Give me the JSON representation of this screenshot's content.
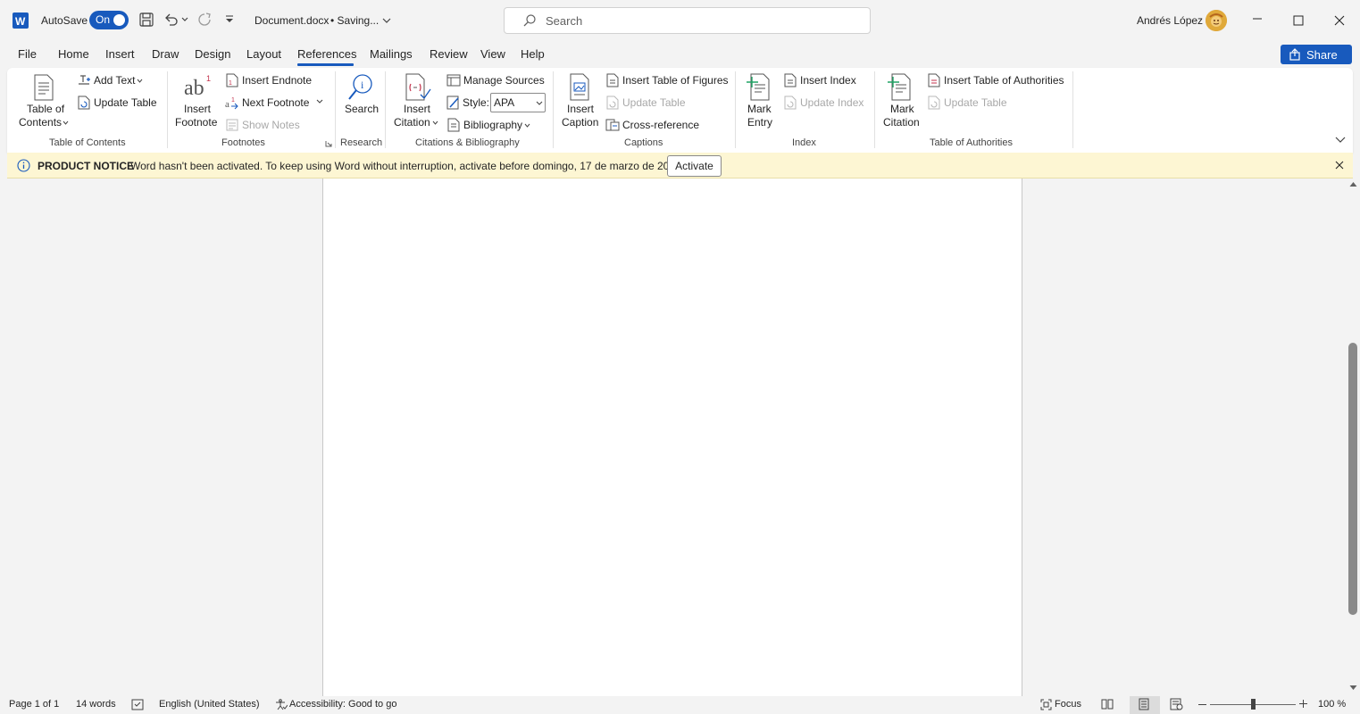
{
  "titlebar": {
    "autosave_label": "AutoSave",
    "autosave_state": "On",
    "doc_title": "Document.docx",
    "save_status": "•  Saving...",
    "search_placeholder": "Search",
    "user_name": "Andrés López"
  },
  "menu": {
    "tabs": [
      "File",
      "Home",
      "Insert",
      "Draw",
      "Design",
      "Layout",
      "References",
      "Mailings",
      "Review",
      "View",
      "Help"
    ],
    "active_tab": "References",
    "share_label": "Share"
  },
  "ribbon": {
    "toc": {
      "table_of_contents_line1": "Table of",
      "table_of_contents_line2": "Contents",
      "add_text": "Add Text",
      "update_table": "Update Table",
      "group_label": "Table of Contents"
    },
    "footnotes": {
      "insert_footnote_line1": "Insert",
      "insert_footnote_line2": "Footnote",
      "insert_endnote": "Insert Endnote",
      "next_footnote": "Next Footnote",
      "show_notes": "Show Notes",
      "group_label": "Footnotes"
    },
    "research": {
      "search": "Search",
      "group_label": "Research"
    },
    "citations": {
      "insert_citation_line1": "Insert",
      "insert_citation_line2": "Citation",
      "manage_sources": "Manage Sources",
      "style_label": "Style:",
      "style_value": "APA",
      "bibliography": "Bibliography",
      "group_label": "Citations & Bibliography"
    },
    "captions": {
      "insert_caption_line1": "Insert",
      "insert_caption_line2": "Caption",
      "insert_table_of_figures": "Insert Table of Figures",
      "update_table": "Update Table",
      "cross_reference": "Cross-reference",
      "group_label": "Captions"
    },
    "index": {
      "mark_entry_line1": "Mark",
      "mark_entry_line2": "Entry",
      "insert_index": "Insert Index",
      "update_index": "Update Index",
      "group_label": "Index"
    },
    "authorities": {
      "mark_citation_line1": "Mark",
      "mark_citation_line2": "Citation",
      "insert_table_of_authorities": "Insert Table of Authorities",
      "update_table": "Update Table",
      "group_label": "Table of Authorities"
    }
  },
  "notice": {
    "title": "PRODUCT NOTICE",
    "message": "Word hasn't been activated. To keep using Word without interruption, activate before domingo, 17 de marzo de 2024.",
    "activate_label": "Activate"
  },
  "statusbar": {
    "page": "Page 1 of 1",
    "words": "14 words",
    "language": "English (United States)",
    "accessibility": "Accessibility: Good to go",
    "focus": "Focus",
    "zoom": "100 %"
  },
  "colors": {
    "accent": "#185abd",
    "notice_bg": "#fdf6d3"
  }
}
